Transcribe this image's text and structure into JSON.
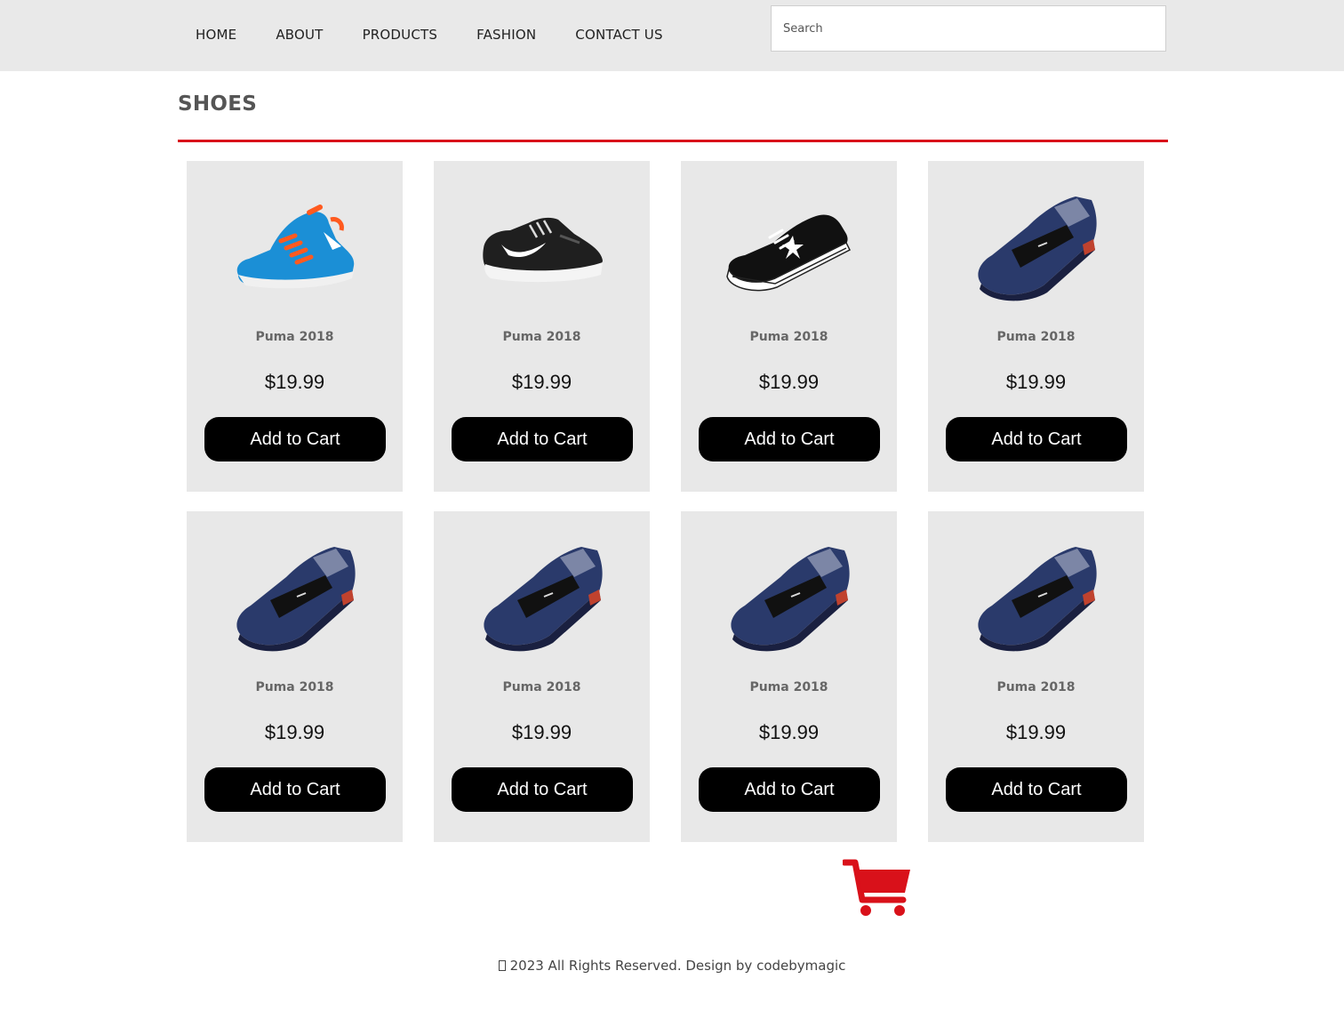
{
  "nav": {
    "items": [
      "HOME",
      "ABOUT",
      "PRODUCTS",
      "FASHION",
      "CONTACT US"
    ]
  },
  "search": {
    "placeholder": "Search"
  },
  "section": {
    "title": "SHOES"
  },
  "products": [
    {
      "name": "Puma 2018",
      "price": "$19.99",
      "button": "Add to Cart",
      "icon": "running-shoe-blue"
    },
    {
      "name": "Puma 2018",
      "price": "$19.99",
      "button": "Add to Cart",
      "icon": "running-shoe-black"
    },
    {
      "name": "Puma 2018",
      "price": "$19.99",
      "button": "Add to Cart",
      "icon": "canvas-sneaker-black"
    },
    {
      "name": "Puma 2018",
      "price": "$19.99",
      "button": "Add to Cart",
      "icon": "loafer-navy"
    },
    {
      "name": "Puma 2018",
      "price": "$19.99",
      "button": "Add to Cart",
      "icon": "loafer-navy"
    },
    {
      "name": "Puma 2018",
      "price": "$19.99",
      "button": "Add to Cart",
      "icon": "loafer-navy"
    },
    {
      "name": "Puma 2018",
      "price": "$19.99",
      "button": "Add to Cart",
      "icon": "loafer-navy"
    },
    {
      "name": "Puma 2018",
      "price": "$19.99",
      "button": "Add to Cart",
      "icon": "loafer-navy"
    }
  ],
  "cart": {
    "icon": "shopping-cart-icon",
    "color": "#d9111a"
  },
  "footer": {
    "text": "2023 All Rights Reserved. Design by codebymagic"
  },
  "colors": {
    "accent": "#d9111a",
    "header_bg": "#e9e9e9",
    "card_bg": "#e8e8e8",
    "button_bg": "#000000"
  }
}
